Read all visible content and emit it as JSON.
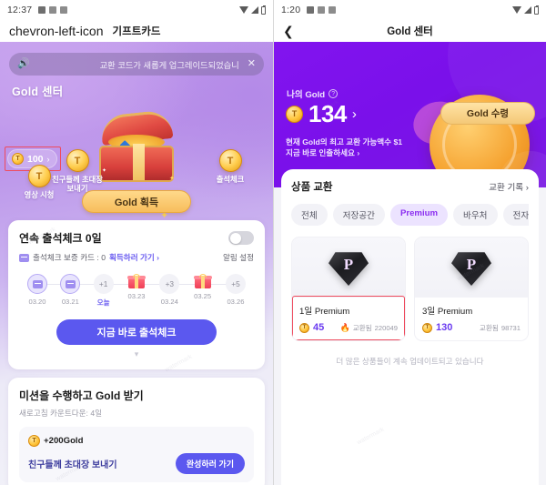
{
  "left": {
    "status": {
      "time": "12:37"
    },
    "nav": {
      "back_icon": "chevron-left-icon",
      "title": "기프트카드"
    },
    "banner": {
      "speaker_icon": "speaker-icon",
      "text": "교환 코드가 새롭게 업그레이드되었습니",
      "close_icon": "close-icon"
    },
    "hero": {
      "title": "Gold 센터",
      "gold_badge": {
        "value": "100",
        "arrow": "›",
        "coin_symbol": "T"
      },
      "primary_button": "Gold 획득",
      "tasks": [
        {
          "name": "task-watch-video",
          "label": "영상 시청",
          "coin_symbol": "T"
        },
        {
          "name": "task-invite-friends",
          "label": "친구들께 초대장\n보내기",
          "coin_symbol": "T"
        },
        {
          "name": "task-attendance",
          "label": "출석체크",
          "coin_symbol": "T"
        }
      ]
    },
    "streak": {
      "title_prefix": "연속 출석체크 ",
      "title_value": "0일",
      "toggle_state": "off",
      "card_label": "출석체크 보증 카드 : 0",
      "card_link": "획득하러 가기 ›",
      "notify_label": "알림 설정",
      "days": [
        {
          "node": "card",
          "label": "03.20",
          "state": "done"
        },
        {
          "node": "card",
          "label": "03.21",
          "state": "done"
        },
        {
          "node": "+1",
          "label": "오늘",
          "state": "today"
        },
        {
          "node": "gift",
          "label": "03.23",
          "state": "gift"
        },
        {
          "node": "+3",
          "label": "03.24",
          "state": "future"
        },
        {
          "node": "gift",
          "label": "03.25",
          "state": "gift"
        },
        {
          "node": "+5",
          "label": "03.26",
          "state": "future"
        }
      ],
      "checkin_button": "지금 바로 출석체크",
      "expand_icon": "chevron-down-icon"
    },
    "mission": {
      "title": "미션을 수행하고 Gold 받기",
      "subtitle": "새로고침 카운트다운: 4일",
      "items": [
        {
          "reward": "+200Gold",
          "task": "친구들께 초대장 보내기",
          "button": "완성하러 가기"
        }
      ]
    }
  },
  "right": {
    "status": {
      "time": "1:20"
    },
    "nav": {
      "back_icon": "chevron-left-icon",
      "title": "Gold 센터"
    },
    "hero": {
      "my_gold_label": "나의 Gold",
      "info_icon": "info-icon",
      "balance": "134",
      "balance_arrow": "›",
      "coin_symbol": "T",
      "claim_button": "Gold 수령",
      "note_line1": "현재 Gold의 최고 교환 가능액수 $1",
      "note_line2": "지금 바로 인출하세요 ›"
    },
    "exchange": {
      "title": "상품 교환",
      "history_link": "교환 기록 ›",
      "tabs": [
        {
          "label": "전체",
          "active": false
        },
        {
          "label": "저장공간",
          "active": false
        },
        {
          "label": "Premium",
          "active": true
        },
        {
          "label": "바우처",
          "active": false
        },
        {
          "label": "전자지",
          "active": false
        }
      ],
      "products": [
        {
          "badge": "P",
          "name": "1일 Premium",
          "price": "45",
          "sold_label": "교환됨",
          "sold_count": "220049",
          "hot": true,
          "highlighted": true
        },
        {
          "badge": "P",
          "name": "3일 Premium",
          "price": "130",
          "sold_label": "교환됨",
          "sold_count": "98731",
          "hot": false,
          "highlighted": false
        }
      ],
      "footer": "더 많은 상품들이 계속 업데이트되고 있습니다"
    }
  },
  "colors": {
    "accent_purple": "#7A10EA",
    "brand_blue": "#5B58EF",
    "gold": "#FFC63D",
    "highlight_red": "#EF4B5E",
    "premium_purple": "#8B2EF0"
  }
}
